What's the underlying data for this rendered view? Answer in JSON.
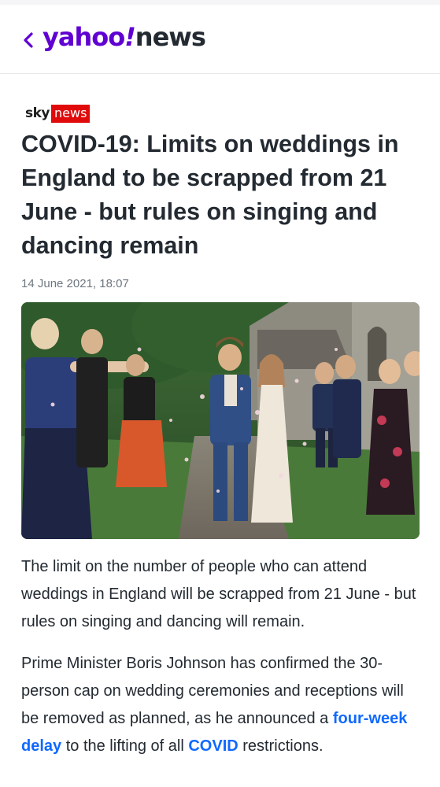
{
  "header": {
    "back_icon": "chevron-left-icon",
    "logo_yahoo": "yahoo",
    "logo_bang": "!",
    "logo_news": "news",
    "brand_color": "#6001d2"
  },
  "article": {
    "source": {
      "sky": "sky",
      "news": "news",
      "news_bg": "#e10a0a"
    },
    "headline": "COVID-19: Limits on weddings in England to be scrapped from 21 June - but rules on singing and dancing remain",
    "date": "14 June 2021, 18:07",
    "hero_image": "wedding-photo",
    "paragraph1": "The limit on the number of people who can attend weddings in England will be scrapped from 21 June - but rules on singing and dancing will remain.",
    "paragraph2": {
      "text_before": "Prime Minister Boris Johnson has confirmed the 30-person cap on wedding ceremonies and receptions will be removed as planned, as he announced a ",
      "link1": "four-week delay",
      "text_middle": " to the lifting of all ",
      "link2": "COVID",
      "text_after": " restrictions.",
      "link_color": "#0f69ff"
    }
  }
}
